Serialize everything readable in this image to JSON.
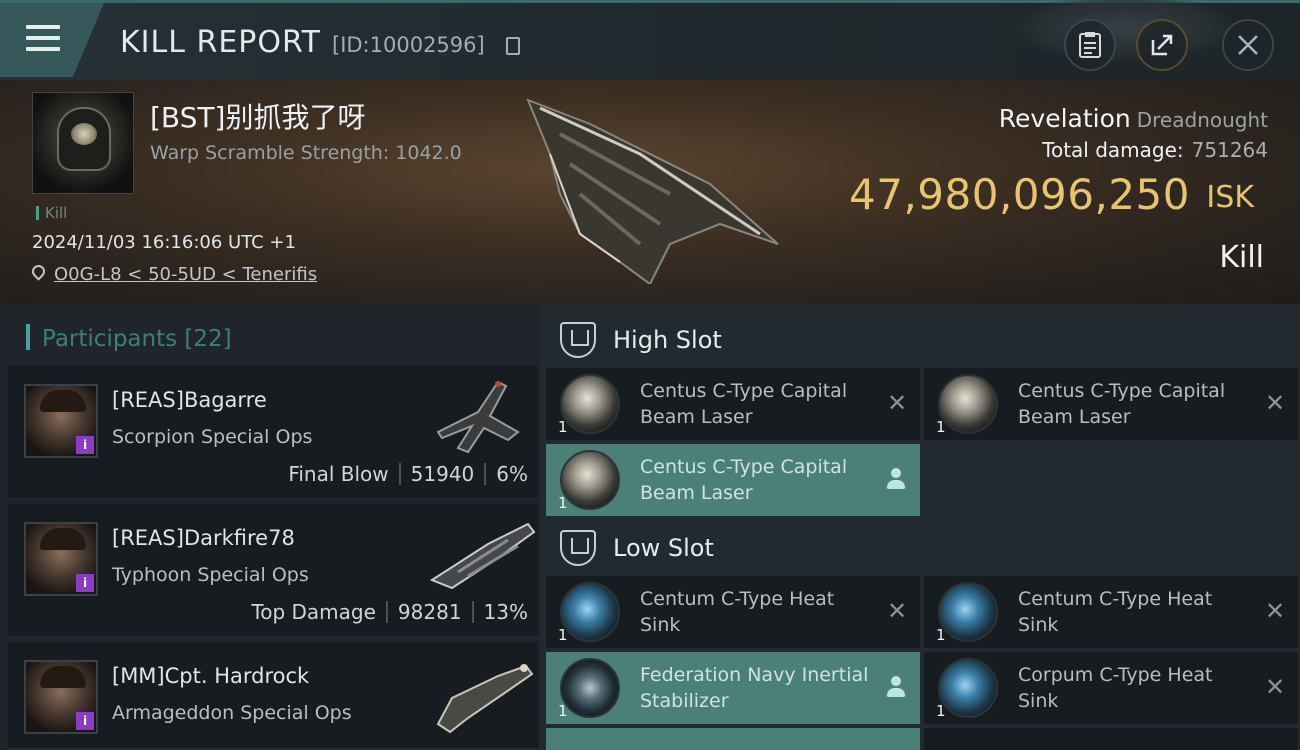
{
  "header": {
    "title": "KILL REPORT",
    "report_id": "[ID:10002596]"
  },
  "victim": {
    "name": "[BST]别抓我了呀",
    "warp_scramble": "Warp Scramble Strength: 1042.0",
    "tag": "Kill",
    "date": "2024/11/03 16:16:06 UTC +1",
    "location": "O0G-L8 < 50-5UD < Tenerifis"
  },
  "ship": {
    "name": "Revelation",
    "class": "Dreadnought",
    "total_damage_label": "Total damage:",
    "total_damage": "751264",
    "isk_value": "47,980,096,250",
    "isk_unit": "ISK",
    "result": "Kill"
  },
  "participants": {
    "header": "Participants [22]",
    "rows": [
      {
        "name": "[REAS]Bagarre",
        "ship": "Scorpion Special Ops",
        "role": "Final Blow",
        "damage": "51940",
        "percent": "6%"
      },
      {
        "name": "[REAS]Darkfire78",
        "ship": "Typhoon Special Ops",
        "role": "Top Damage",
        "damage": "98281",
        "percent": "13%"
      },
      {
        "name": "[MM]Cpt. Hardrock",
        "ship": "Armageddon Special Ops"
      }
    ]
  },
  "fitting": {
    "high_slot": {
      "title": "High Slot",
      "modules": [
        {
          "qty": "1",
          "name": "Centus C-Type Capital Beam Laser"
        },
        {
          "qty": "1",
          "name": "Centus C-Type Capital Beam Laser"
        },
        {
          "qty": "1",
          "name": "Centus C-Type Capital Beam Laser"
        }
      ]
    },
    "low_slot": {
      "title": "Low Slot",
      "modules": [
        {
          "qty": "1",
          "name": "Centum C-Type Heat Sink"
        },
        {
          "qty": "1",
          "name": "Centum C-Type Heat Sink"
        },
        {
          "qty": "1",
          "name": "Federation Navy Inertial Stabilizer"
        },
        {
          "qty": "1",
          "name": "Corpum C-Type Heat Sink"
        }
      ]
    }
  }
}
